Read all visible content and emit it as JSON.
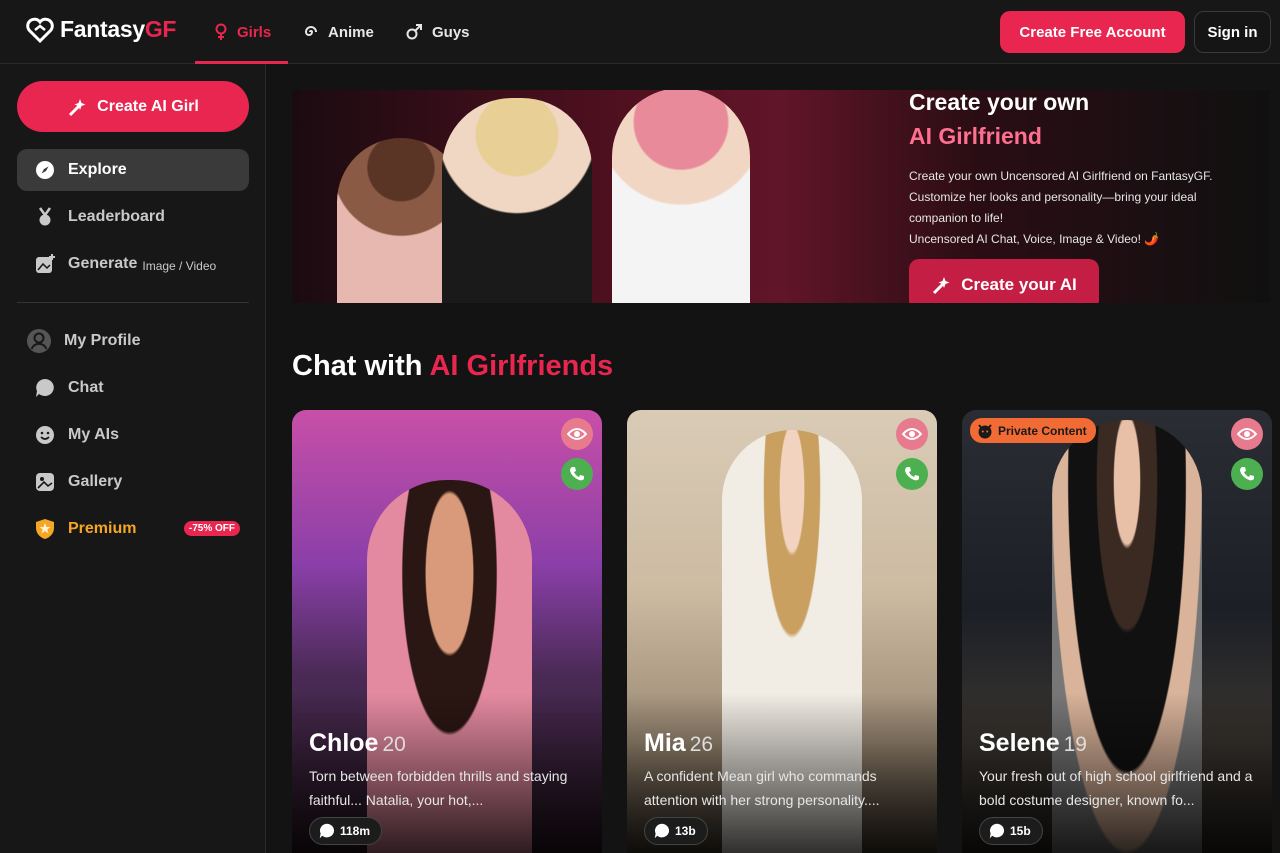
{
  "header": {
    "logo_main": "Fantasy",
    "logo_accent": "GF",
    "tabs": [
      {
        "label": "Girls",
        "active": true
      },
      {
        "label": "Anime",
        "active": false
      },
      {
        "label": "Guys",
        "active": false
      }
    ],
    "create_account_label": "Create Free Account",
    "sign_in_label": "Sign in"
  },
  "sidebar": {
    "create_button_label": "Create AI Girl",
    "items": [
      {
        "label": "Explore",
        "icon": "compass-icon",
        "active": true
      },
      {
        "label": "Leaderboard",
        "icon": "medal-icon"
      },
      {
        "label": "Generate",
        "sublabel": "Image / Video",
        "icon": "image-plus-icon"
      },
      {
        "label": "My Profile",
        "icon": "user-icon"
      },
      {
        "label": "Chat",
        "icon": "chat-icon"
      },
      {
        "label": "My AIs",
        "icon": "smile-icon"
      },
      {
        "label": "Gallery",
        "icon": "gallery-icon"
      },
      {
        "label": "Premium",
        "icon": "shield-icon",
        "badge": "-75% OFF"
      }
    ]
  },
  "banner": {
    "title_line1": "Create your own",
    "title_line2": "AI Girlfriend",
    "text_line1": "Create your own Uncensored AI Girlfriend on FantasyGF.",
    "text_line2": "Customize her looks and personality—bring your ideal",
    "text_line3": "companion to life!",
    "text_line4": "Uncensored AI Chat, Voice, Image & Video! 🌶️",
    "button_label": "Create your AI"
  },
  "section": {
    "title_main": "Chat with",
    "title_accent": "AI Girlfriends"
  },
  "cards": [
    {
      "name": "Chloe",
      "age": "20",
      "desc": "Torn between forbidden thrills and staying faithful... Natalia, your hot,...",
      "count": "118m",
      "private": false
    },
    {
      "name": "Mia",
      "age": "26",
      "desc": "A confident Mean girl who commands attention with her strong personality....",
      "count": "13b",
      "private": false
    },
    {
      "name": "Selene",
      "age": "19",
      "desc": "Your fresh out of high school girlfriend and a bold costume designer, known fo...",
      "count": "15b",
      "private": true,
      "badge": "Private Content"
    }
  ],
  "colors": {
    "accent": "#e8264f",
    "premium": "#f5a623",
    "call": "#4caf50",
    "eye": "#e87a8e",
    "private_badge": "#f26b35"
  }
}
